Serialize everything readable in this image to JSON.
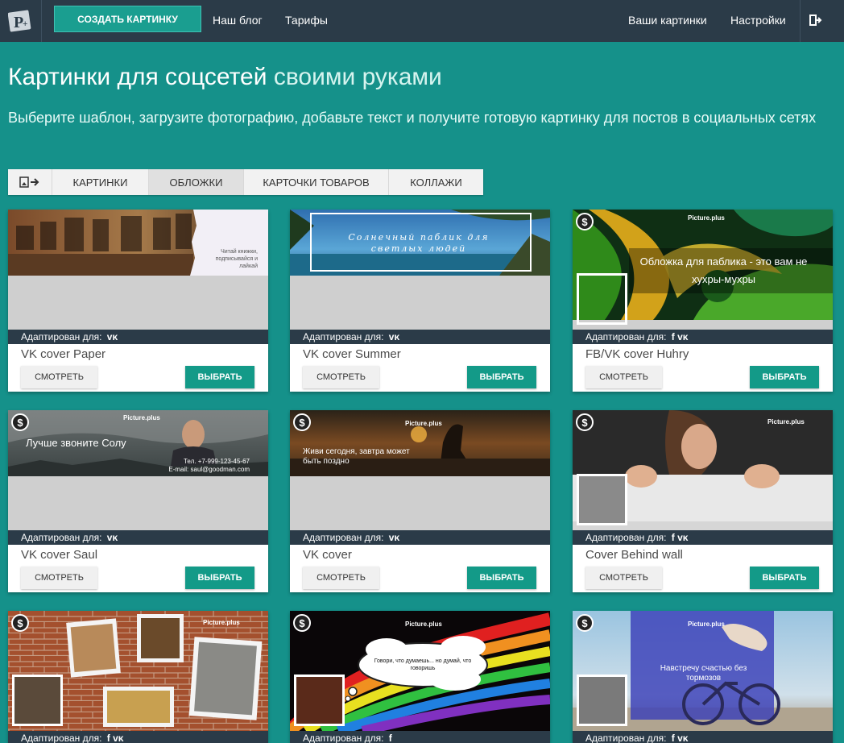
{
  "nav": {
    "create_label": "Создать картинку",
    "blog": "Наш блог",
    "tariffs": "Тарифы",
    "your_images": "Ваши картинки",
    "settings": "Настройки"
  },
  "hero": {
    "title_main": "Картинки для соцсетей",
    "title_accent": "своими руками",
    "subtitle": "Выберите шаблон, загрузите фотографию, добавьте текст и получите готовую картинку для постов в социальных сетях"
  },
  "tabs": [
    {
      "label": "Картинки"
    },
    {
      "label": "Обложки"
    },
    {
      "label": "Карточки товаров"
    },
    {
      "label": "Коллажи"
    }
  ],
  "card_common": {
    "adapted_label": "Адаптирован для:",
    "view_label": "Смотреть",
    "choose_label": "Выбрать",
    "paid_symbol": "$"
  },
  "cards": [
    {
      "name": "VK cover Paper",
      "platforms": "ᴠᴋ",
      "caption": "Читай книжки, подписывайся и лайкай"
    },
    {
      "name": "VK cover Summer",
      "platforms": "ᴠᴋ",
      "caption": "Солнечный паблик для светлых людей"
    },
    {
      "name": "FB/VK cover Huhry",
      "platforms": "f ᴠᴋ",
      "caption": "Обложка для паблика - это вам не хухры-мухры",
      "brand": "Picture.plus"
    },
    {
      "name": "VK cover Saul",
      "platforms": "ᴠᴋ",
      "caption": "Лучше звоните Солу",
      "phone": "Тел. +7-999-123-45-67",
      "email": "E-mail: saul@goodman.com",
      "brand": "Picture.plus"
    },
    {
      "name": "VK cover",
      "platforms": "ᴠᴋ",
      "caption": "Живи сегодня, завтра может быть поздно",
      "brand": "Picture.plus"
    },
    {
      "name": "Cover Behind wall",
      "platforms": "f ᴠᴋ",
      "brand": "Picture.plus"
    },
    {
      "name": "",
      "platforms": "f ᴠᴋ",
      "brand": "Picture.plus"
    },
    {
      "name": "",
      "platforms": "f",
      "caption": "Говори, что думаешь... но думай, что говоришь",
      "brand": "Picture.plus"
    },
    {
      "name": "",
      "platforms": "f ᴠᴋ",
      "caption": "Навстречу счастью без тормозов",
      "brand": "Picture.plus"
    }
  ],
  "colors": {
    "page_bg": "#15918a",
    "nav_bg": "#2b3b48",
    "accent_button": "#139a88"
  }
}
